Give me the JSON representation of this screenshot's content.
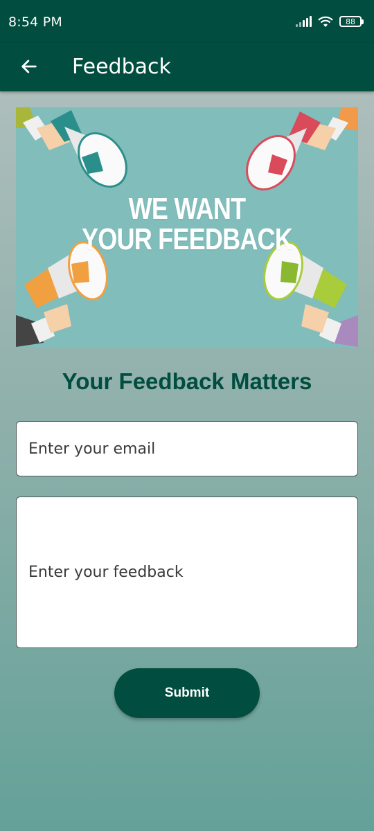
{
  "status_bar": {
    "time": "8:54 PM",
    "battery": "88",
    "icons": [
      "signal-icon",
      "wifi-icon",
      "battery-icon"
    ]
  },
  "app_bar": {
    "title": "Feedback",
    "back_icon": "arrow-left-icon"
  },
  "banner": {
    "line1": "WE WANT",
    "line2": "YOUR FEEDBACK"
  },
  "form": {
    "heading": "Your Feedback Matters",
    "email_placeholder": "Enter your email",
    "feedback_placeholder": "Enter your feedback",
    "submit_label": "Submit"
  },
  "colors": {
    "primary": "#014d3f",
    "banner_bg": "#80bdbb"
  }
}
